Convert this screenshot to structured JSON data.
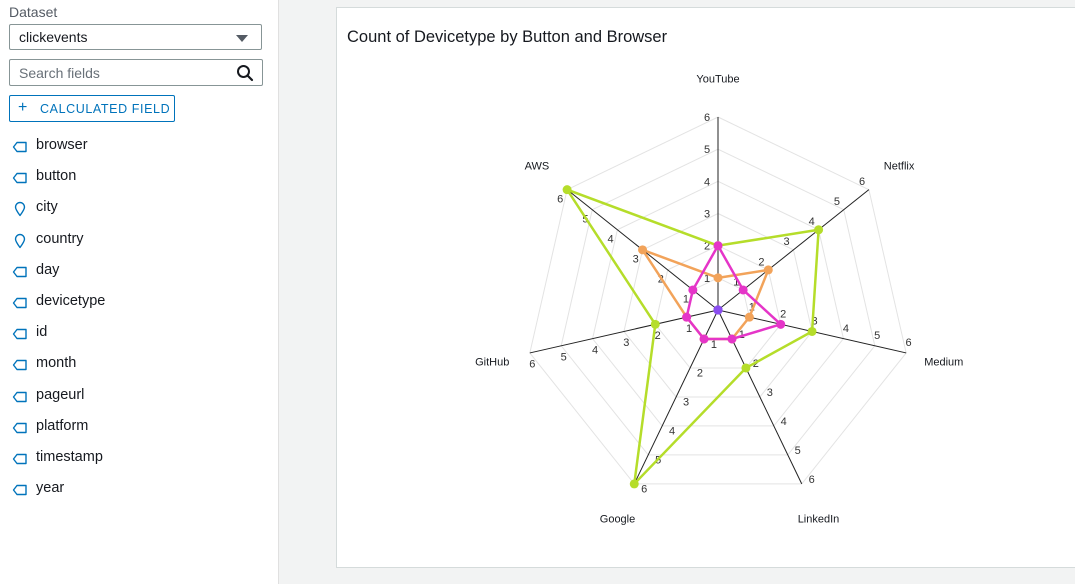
{
  "dataset": {
    "label": "Dataset",
    "value": "clickevents"
  },
  "search": {
    "placeholder": "Search fields"
  },
  "calc_button": {
    "plus": "+",
    "label": "CALCULATED FIELD"
  },
  "fields": [
    {
      "label": "browser",
      "icon": "dimension-tag-icon"
    },
    {
      "label": "button",
      "icon": "dimension-tag-icon"
    },
    {
      "label": "city",
      "icon": "geo-pin-icon"
    },
    {
      "label": "country",
      "icon": "geo-pin-icon"
    },
    {
      "label": "day",
      "icon": "dimension-tag-icon"
    },
    {
      "label": "devicetype",
      "icon": "dimension-tag-icon"
    },
    {
      "label": "id",
      "icon": "dimension-tag-icon"
    },
    {
      "label": "month",
      "icon": "dimension-tag-icon"
    },
    {
      "label": "pageurl",
      "icon": "dimension-tag-icon"
    },
    {
      "label": "platform",
      "icon": "dimension-tag-icon"
    },
    {
      "label": "timestamp",
      "icon": "dimension-tag-icon"
    },
    {
      "label": "year",
      "icon": "dimension-tag-icon"
    }
  ],
  "colors": {
    "accent": "#0073bb",
    "dim_icon": "#0073bb"
  },
  "visual": {
    "title": "Count of Devicetype by Button and Browser"
  },
  "chart_data": {
    "type": "radar",
    "title": "Count of Devicetype by Button and Browser",
    "axes": [
      "YouTube",
      "Netflix",
      "Medium",
      "LinkedIn",
      "Google",
      "GitHub",
      "AWS"
    ],
    "rlim": [
      0,
      6
    ],
    "ticks": [
      "1",
      "2",
      "3",
      "4",
      "5",
      "6"
    ],
    "grid": true,
    "series": [
      {
        "color": "#b5dd2a",
        "values": [
          2,
          4,
          3,
          2,
          6,
          2,
          6
        ]
      },
      {
        "color": "#f2a35a",
        "values": [
          1,
          2,
          1,
          1,
          1,
          1,
          3
        ]
      },
      {
        "color": "#e535c8",
        "values": [
          2,
          1,
          2,
          1,
          1,
          1,
          1
        ]
      },
      {
        "color": "#8a4df0",
        "values": [
          0,
          0,
          0,
          0,
          0,
          0,
          0
        ]
      }
    ]
  }
}
